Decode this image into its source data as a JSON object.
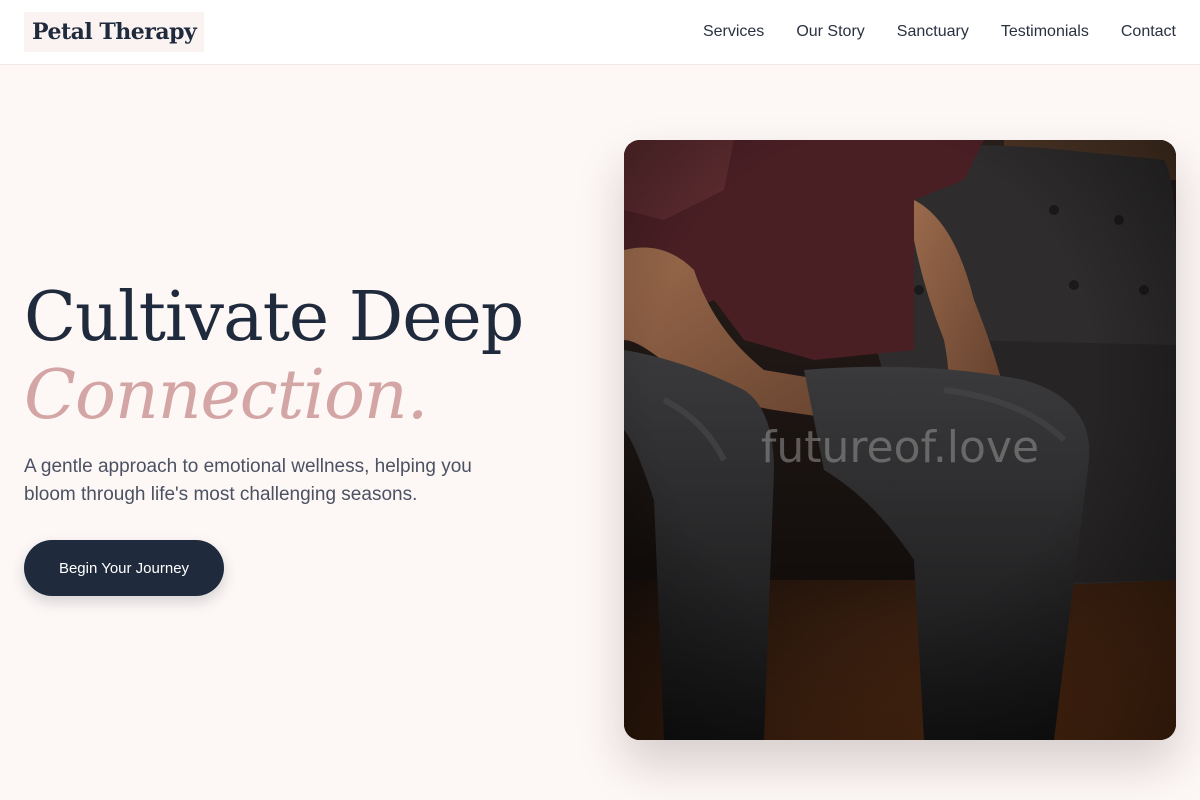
{
  "brand": {
    "name": "Petal Therapy"
  },
  "nav": {
    "items": [
      {
        "label": "Services"
      },
      {
        "label": "Our Story"
      },
      {
        "label": "Sanctuary"
      },
      {
        "label": "Testimonials"
      },
      {
        "label": "Contact"
      }
    ]
  },
  "hero": {
    "title": "Cultivate Deep",
    "accent": "Connection.",
    "subtitle": "A gentle approach to emotional wellness, helping you bloom through life's most challenging seasons.",
    "cta_label": "Begin Your Journey",
    "image": {
      "watermark": "futureof.love"
    }
  },
  "colors": {
    "page_background": "#fdf7f6",
    "header_background": "#ffffff",
    "primary_navy": "#1f2a3c",
    "accent_rose": "#d4a5a5",
    "body_text": "#4b5262"
  }
}
